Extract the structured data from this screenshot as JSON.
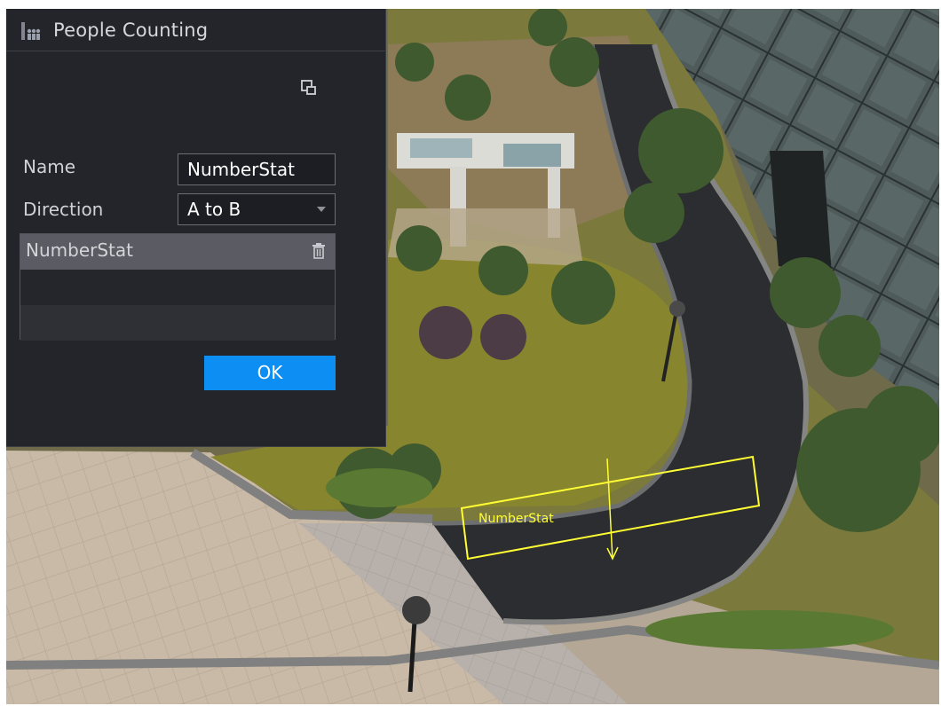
{
  "dialog": {
    "title": "People Counting",
    "title_icon": "people-counting-icon",
    "restore_icon": "restore-window-icon"
  },
  "form": {
    "name_label": "Name",
    "name_value": "NumberStat",
    "direction_label": "Direction",
    "direction_value": "A to B",
    "direction_caret_icon": "dropdown-caret-icon"
  },
  "rules": [
    {
      "label": "NumberStat",
      "selected": true,
      "delete_icon": "trash-icon"
    },
    {
      "label": ""
    },
    {
      "label": ""
    }
  ],
  "buttons": {
    "ok": "OK"
  },
  "video": {
    "rule_label": "NumberStat",
    "rule_color": "#ffff33"
  },
  "colors": {
    "panel_bg": "#24252b",
    "selected_row": "#5b5c63",
    "accent": "#0d8ef2"
  }
}
